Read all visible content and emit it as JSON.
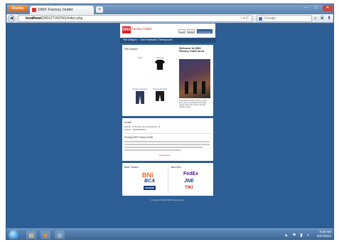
{
  "browser": {
    "firefox_label": "Firefox",
    "tab_title": "DMX Factory Outlet",
    "new_tab": "+",
    "back": "◀",
    "url_host": "localhost",
    "url_path": "/DMXZTONTAS/index.php",
    "search_placeholder": "Google",
    "nav_icons": "☆ ▾ C",
    "right_icons": "⌕ ▣ ⬇ ⌂"
  },
  "site": {
    "logo_mark": "DMX",
    "logo_text": "Factory Outlet",
    "header_buttons": [
      "Login",
      "Daftar",
      "Cek Pesanan"
    ],
    "menu": [
      "Pilih Kategori ▾",
      "Cara Pemesanan",
      "Tentang Kami"
    ],
    "products_title": "Pilih Kategori",
    "products": [
      {
        "label": "Kaos",
        "kind": "shirt",
        "color": "#ffffff"
      },
      {
        "label": "Kemeja",
        "kind": "shirt",
        "color": "#111111"
      },
      {
        "label": "Celana Panjang",
        "kind": "pants",
        "color": "#2b3b57"
      },
      {
        "label": "Celana Pendek",
        "kind": "pants",
        "color": "#1c1c1c"
      }
    ],
    "welcome_title": "Welcome to DMX Factory Outlet Area",
    "welcome_caption": "Toko Pakaian DMX Factory Outlet, toko yang menyediakan berbagai macam kaos dan celana dengan kualitas tinggi.",
    "contact_title": "Kontak",
    "contact_lines": [
      "Alamat : Jl. Ahmad Yani Lampung No. 11",
      "Telepon : 0812345678xx"
    ],
    "about_title": "Tentang DMX Factory Outlet",
    "read_more": "Selanjutnya",
    "payment_title": "Bank Transfer",
    "payment_banks": [
      "BNI",
      "BCA",
      "MANDIRI"
    ],
    "shipping_title": "Jasa Kirim",
    "shipping_couriers": [
      "FedEx",
      "JNE",
      "TIKI"
    ],
    "footer": "Copyright © 2014 DMX Factory Outlet"
  },
  "taskbar": {
    "time": "9:39 AM",
    "date": "6/27/2014",
    "tray_icons": "▲ ⚑ ▮ ◖"
  },
  "colors": {
    "page_bg": "#2d5e95",
    "menu_bg": "#244d7c",
    "brand_red": "#dd2222",
    "bni": "#f26522",
    "bca": "#1f3f9c",
    "mandiri": "#163a75"
  }
}
